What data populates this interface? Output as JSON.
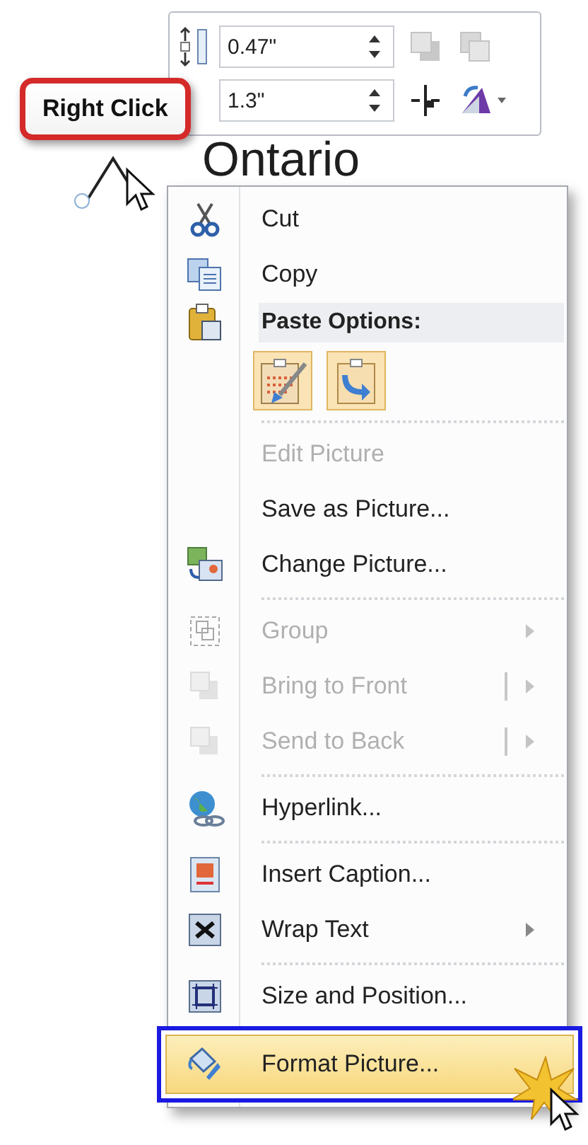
{
  "toolbar": {
    "fields": [
      {
        "value": "0.47\""
      },
      {
        "value": "1.3\""
      }
    ]
  },
  "document_text": "Ontario",
  "callout": "Right Click",
  "menu": [
    {
      "kind": "item",
      "label": "Cut",
      "disabled": false,
      "submenu": false,
      "split": false,
      "highlighted": false
    },
    {
      "kind": "item",
      "label": "Copy",
      "disabled": false,
      "submenu": false,
      "split": false,
      "highlighted": false
    },
    {
      "kind": "header",
      "label": "Paste Options:"
    },
    {
      "kind": "paste_row"
    },
    {
      "kind": "separator"
    },
    {
      "kind": "item",
      "label": "Edit Picture",
      "disabled": true,
      "submenu": false,
      "split": false,
      "highlighted": false
    },
    {
      "kind": "item",
      "label": "Save as Picture...",
      "disabled": false,
      "submenu": false,
      "split": false,
      "highlighted": false
    },
    {
      "kind": "item",
      "label": "Change Picture...",
      "disabled": false,
      "submenu": false,
      "split": false,
      "highlighted": false
    },
    {
      "kind": "separator"
    },
    {
      "kind": "item",
      "label": "Group",
      "disabled": true,
      "submenu": true,
      "split": false,
      "highlighted": false
    },
    {
      "kind": "item",
      "label": "Bring to Front",
      "disabled": true,
      "submenu": true,
      "split": true,
      "highlighted": false
    },
    {
      "kind": "item",
      "label": "Send to Back",
      "disabled": true,
      "submenu": true,
      "split": true,
      "highlighted": false
    },
    {
      "kind": "separator"
    },
    {
      "kind": "item",
      "label": "Hyperlink...",
      "disabled": false,
      "submenu": false,
      "split": false,
      "highlighted": false
    },
    {
      "kind": "separator"
    },
    {
      "kind": "item",
      "label": "Insert Caption...",
      "disabled": false,
      "submenu": false,
      "split": false,
      "highlighted": false
    },
    {
      "kind": "item",
      "label": "Wrap Text",
      "disabled": false,
      "submenu": true,
      "split": false,
      "highlighted": false
    },
    {
      "kind": "separator"
    },
    {
      "kind": "item",
      "label": "Size and Position...",
      "disabled": false,
      "submenu": false,
      "split": false,
      "highlighted": false
    },
    {
      "kind": "item",
      "label": "Format Picture...",
      "disabled": false,
      "submenu": false,
      "split": false,
      "highlighted": true
    }
  ]
}
